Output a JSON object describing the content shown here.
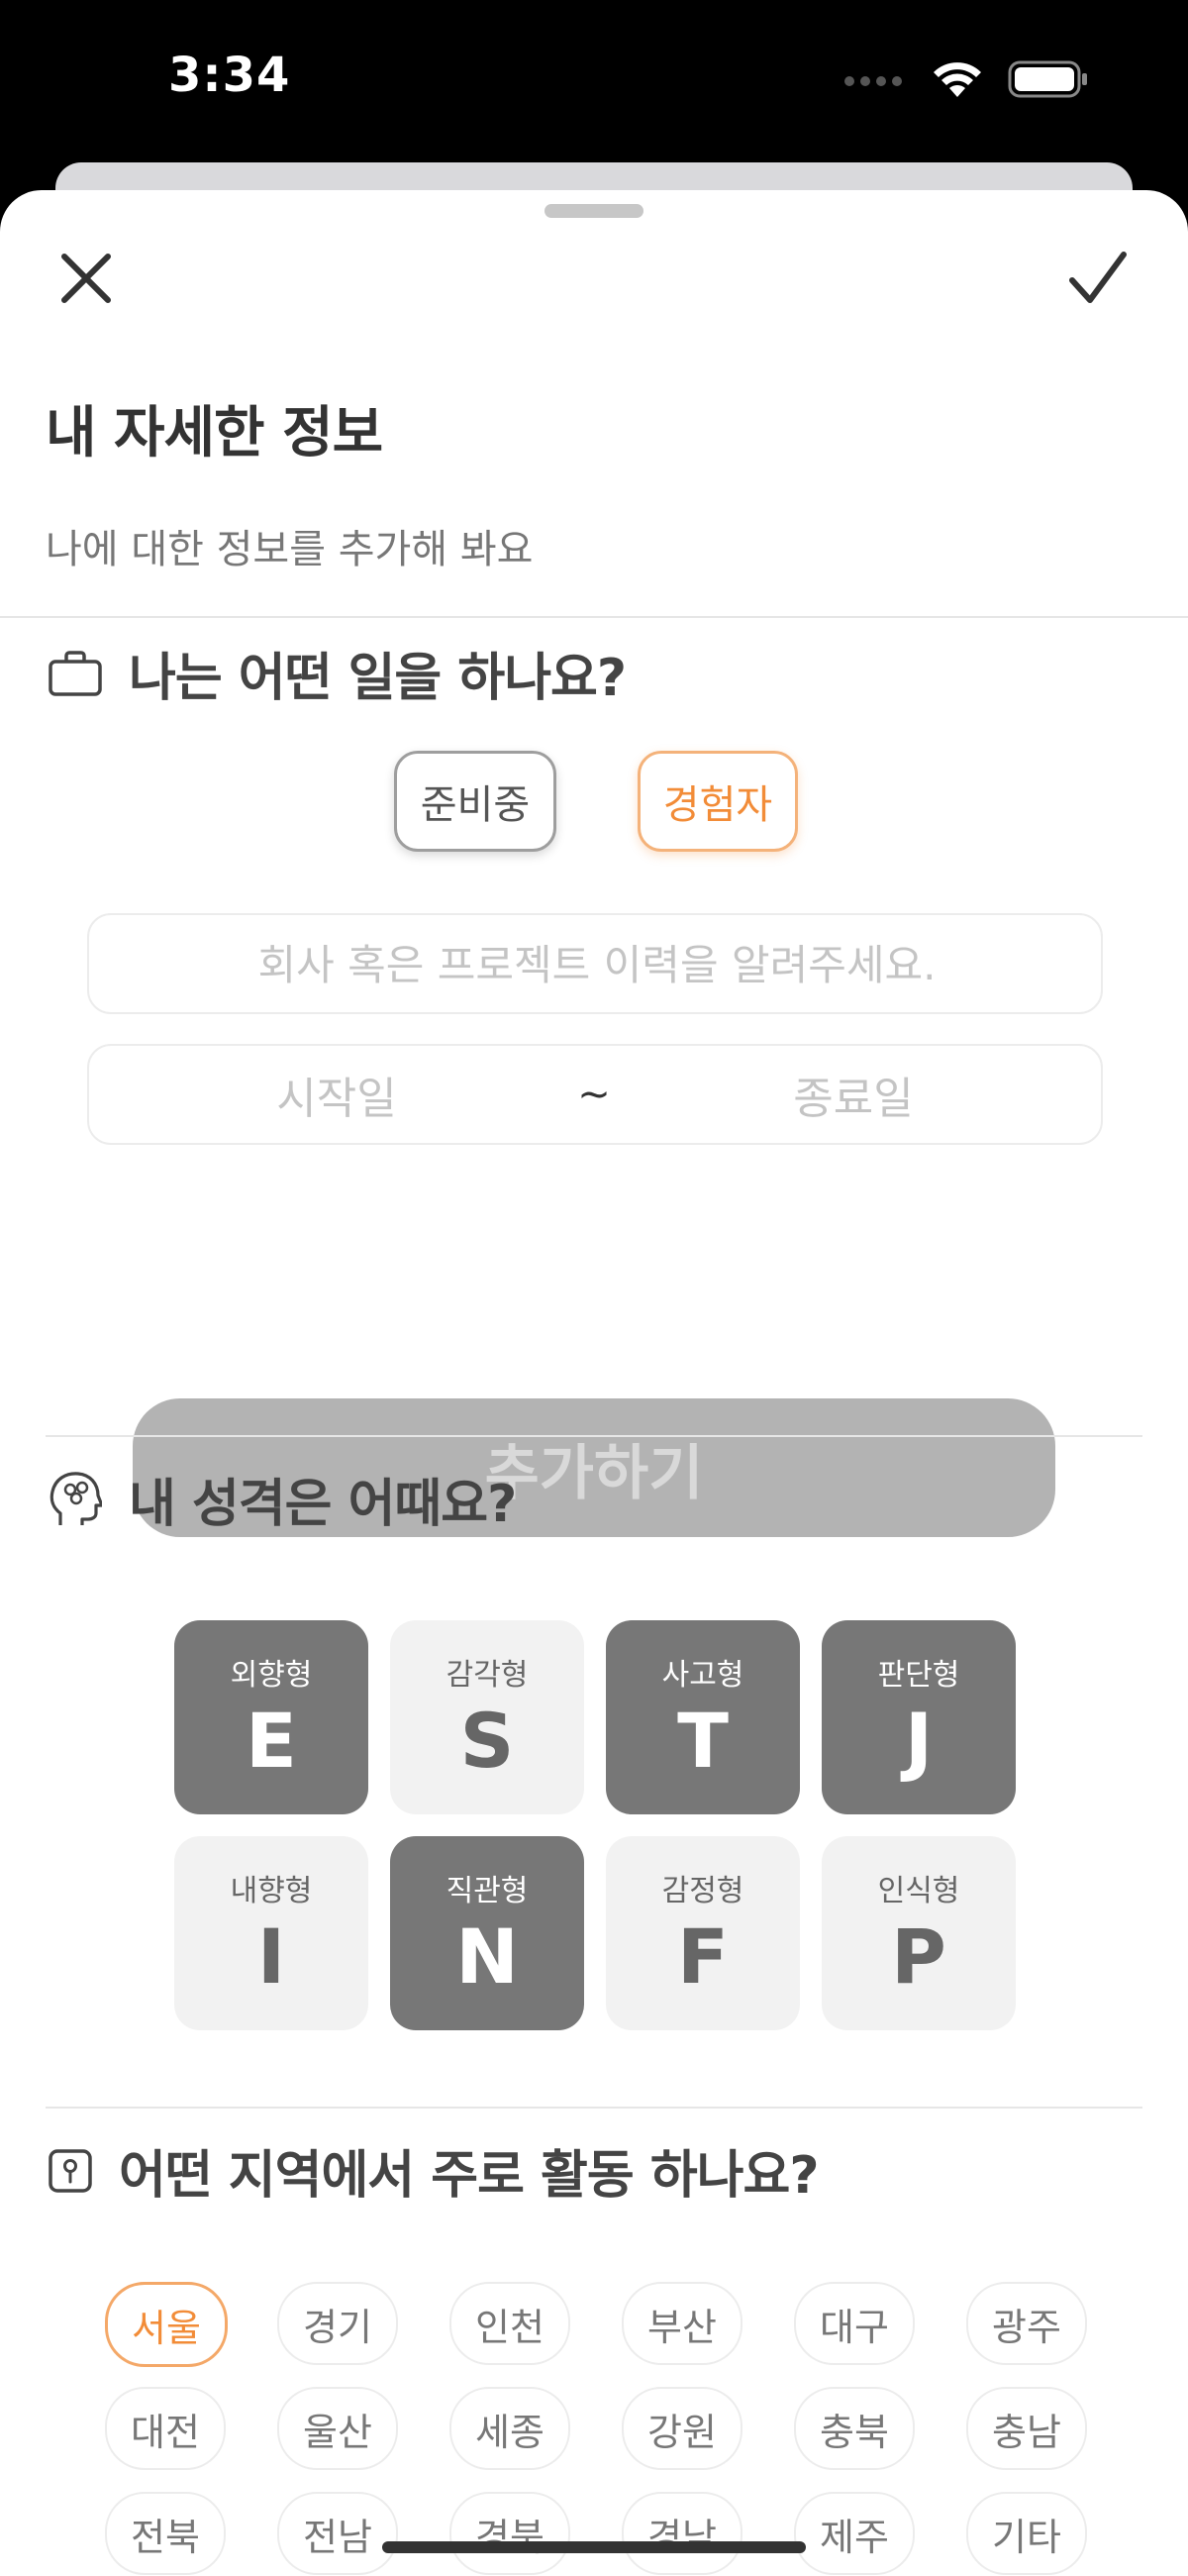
{
  "status": {
    "time": "3:34"
  },
  "header": {
    "title": "내 자세한 정보",
    "subtitle": "나에 대한 정보를 추가해 봐요"
  },
  "icons": {
    "close": "close-icon",
    "confirm": "checkmark-icon",
    "work": "briefcase-icon",
    "personality": "head-brain-icon",
    "region": "location-icon"
  },
  "work": {
    "section_title": "나는 어떤 일을 하나요?",
    "toggle": [
      {
        "label": "준비중",
        "selected": false
      },
      {
        "label": "경험자",
        "selected": true
      }
    ],
    "history_placeholder": "회사 혹은 프로젝트 이력을 알려주세요.",
    "start_placeholder": "시작일",
    "separator": "~",
    "end_placeholder": "종료일",
    "add_label": "추가하기"
  },
  "personality": {
    "section_title": "내 성격은 어때요?",
    "tiles": [
      {
        "label": "외향형",
        "letter": "E",
        "selected": true
      },
      {
        "label": "감각형",
        "letter": "S",
        "selected": false
      },
      {
        "label": "사고형",
        "letter": "T",
        "selected": true
      },
      {
        "label": "판단형",
        "letter": "J",
        "selected": true
      },
      {
        "label": "내향형",
        "letter": "I",
        "selected": false
      },
      {
        "label": "직관형",
        "letter": "N",
        "selected": true
      },
      {
        "label": "감정형",
        "letter": "F",
        "selected": false
      },
      {
        "label": "인식형",
        "letter": "P",
        "selected": false
      }
    ]
  },
  "region": {
    "section_title": "어떤 지역에서 주로 활동 하나요?",
    "selected": "서울",
    "chips": [
      "서울",
      "경기",
      "인천",
      "부산",
      "대구",
      "광주",
      "대전",
      "울산",
      "세종",
      "강원",
      "충북",
      "충남",
      "전북",
      "전남",
      "경북",
      "경남",
      "제주",
      "기타"
    ]
  },
  "colors": {
    "accent": "#f28c38",
    "selected_tile": "#777777",
    "disabled_button": "#b3b3b3"
  }
}
